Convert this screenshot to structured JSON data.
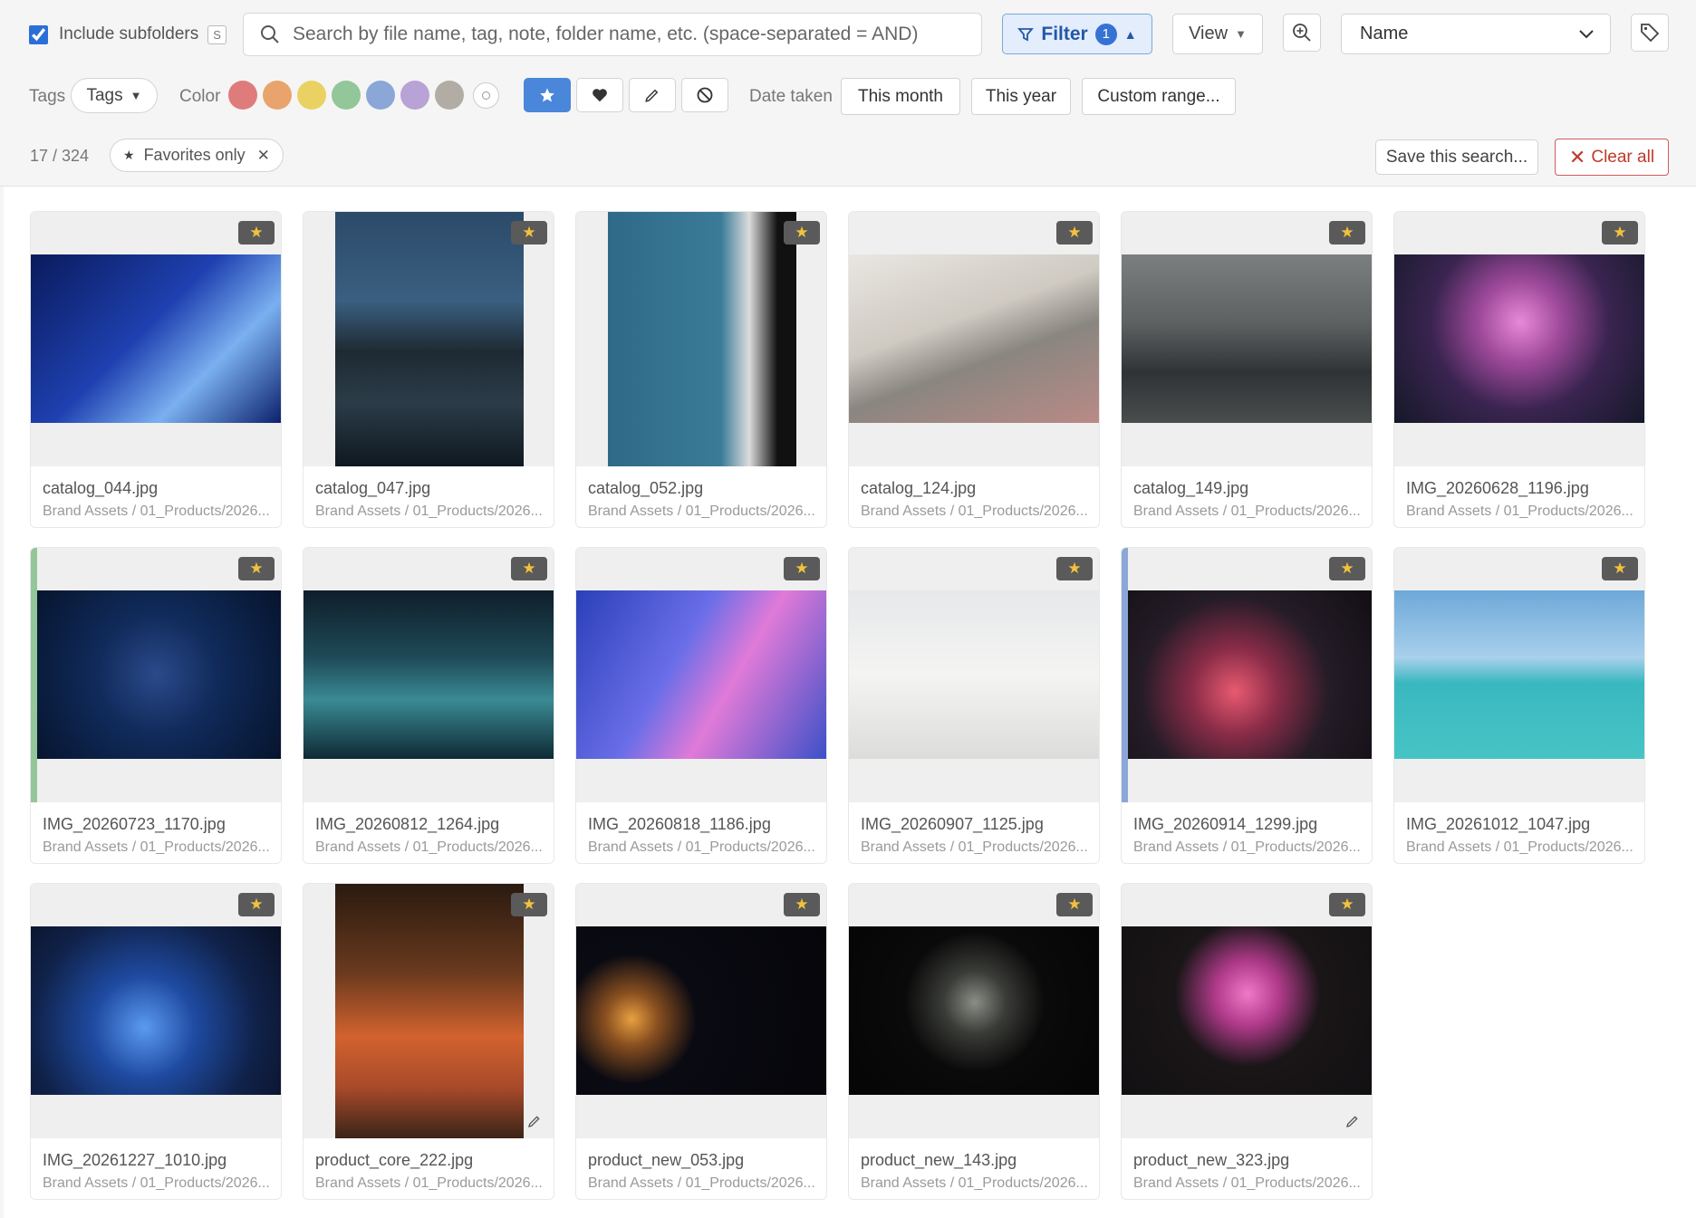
{
  "toolbar": {
    "include_subfolders": {
      "label": "Include subfolders",
      "shortcut": "S",
      "checked": true
    },
    "search": {
      "placeholder": "Search by file name, tag, note, folder name, etc. (space-separated = AND)",
      "value": ""
    },
    "filter": {
      "label": "Filter",
      "count": "1",
      "caret": "▲"
    },
    "view": {
      "label": "View",
      "caret": "▼"
    },
    "sort": {
      "selected": "Name",
      "options": [
        "Name"
      ]
    }
  },
  "filters": {
    "tags_label": "Tags",
    "tags_dropdown": "Tags",
    "color_label": "Color",
    "colors": [
      "#e07b7b",
      "#e8a46c",
      "#e9d263",
      "#93c699",
      "#8ba7d8",
      "#b9a2d6",
      "#b1ada4"
    ],
    "marks": [
      "star",
      "heart",
      "pencil",
      "none"
    ],
    "active_mark": "star",
    "date_label": "Date taken",
    "date_options": [
      "This month",
      "This year",
      "Custom range..."
    ]
  },
  "status": {
    "count": "17 / 324",
    "chip_label": "Favorites only",
    "save_label": "Save this search...",
    "clear_label": "Clear all"
  },
  "items": [
    {
      "name": "catalog_044.jpg",
      "path": "Brand Assets / 01_Products/2026...",
      "orientation": "landscape",
      "bg": "linear-gradient(135deg,#0a1a5c 0%,#1e40b0 45%,#7ab0f0 70%,#0a1f6a 100%)"
    },
    {
      "name": "catalog_047.jpg",
      "path": "Brand Assets / 01_Products/2026...",
      "orientation": "portrait",
      "bg": "linear-gradient(180deg,#2c4a6a 0%,#3a5f80 35%,#1e2a33 55%,#2b3c48 75%,#0f1820 100%)"
    },
    {
      "name": "catalog_052.jpg",
      "path": "Brand Assets / 01_Products/2026...",
      "orientation": "portrait",
      "bg": "linear-gradient(90deg,#2f6a88 0%,#3a7b98 60%,#dcdcdc 75%,#111 90%)"
    },
    {
      "name": "catalog_124.jpg",
      "path": "Brand Assets / 01_Products/2026...",
      "orientation": "landscape",
      "bg": "linear-gradient(160deg,#e9e6e1 0%,#cfcac2 40%,#8a8680 60%,#b98a86 100%)"
    },
    {
      "name": "catalog_149.jpg",
      "path": "Brand Assets / 01_Products/2026...",
      "orientation": "landscape",
      "bg": "linear-gradient(180deg,#7b7f80 0%,#5e6263 40%,#2f3335 70%,#4a4d4e 100%)"
    },
    {
      "name": "IMG_20260628_1196.jpg",
      "path": "Brand Assets / 01_Products/2026...",
      "orientation": "landscape",
      "bg": "radial-gradient(circle at 50% 40%,#e889d6 0%,#a04a9c 25%,#3a2450 55%,#141828 100%)"
    },
    {
      "name": "IMG_20260723_1170.jpg",
      "path": "Brand Assets / 01_Products/2026...",
      "orientation": "landscape",
      "bg": "radial-gradient(circle at 50% 50%,#2a4a8a 0%,#102a5a 40%,#06142c 100%)",
      "label_color": "#93c699"
    },
    {
      "name": "IMG_20260812_1264.jpg",
      "path": "Brand Assets / 01_Products/2026...",
      "orientation": "landscape",
      "bg": "linear-gradient(180deg,#0e1e2a 0%,#1f4a58 40%,#3a8a94 65%,#0e2a34 100%)"
    },
    {
      "name": "IMG_20260818_1186.jpg",
      "path": "Brand Assets / 01_Products/2026...",
      "orientation": "landscape",
      "bg": "linear-gradient(120deg,#2a40b8 0%,#6a6ee8 40%,#e07ad8 60%,#3a50c8 100%)"
    },
    {
      "name": "IMG_20260907_1125.jpg",
      "path": "Brand Assets / 01_Products/2026...",
      "orientation": "landscape",
      "bg": "linear-gradient(180deg,#e6e8ea 0%,#f4f4f2 50%,#dcdcda 100%)"
    },
    {
      "name": "IMG_20260914_1299.jpg",
      "path": "Brand Assets / 01_Products/2026...",
      "orientation": "landscape",
      "bg": "radial-gradient(circle at 45% 60%,#e85a70 0%,#8a2c48 25%,#241c26 55%,#120e14 100%)",
      "label_color": "#8ba7d8"
    },
    {
      "name": "IMG_20261012_1047.jpg",
      "path": "Brand Assets / 01_Products/2026...",
      "orientation": "landscape",
      "bg": "linear-gradient(180deg,#6ea8d8 0%,#a8d0ec 40%,#3ab8c0 55%,#46c4c4 100%)"
    },
    {
      "name": "IMG_20261227_1010.jpg",
      "path": "Brand Assets / 01_Products/2026...",
      "orientation": "landscape",
      "bg": "radial-gradient(circle at 45% 60%,#5a9af0 0%,#1e4aa0 30%,#10224a 65%,#0a1024 100%)"
    },
    {
      "name": "product_core_222.jpg",
      "path": "Brand Assets / 01_Products/2026...",
      "orientation": "portrait",
      "bg": "linear-gradient(180deg,#2a1a10 0%,#6a3a1e 35%,#d2622e 60%,#a84a2a 80%,#3a2418 100%)",
      "edited": true
    },
    {
      "name": "product_new_053.jpg",
      "path": "Brand Assets / 01_Products/2026...",
      "orientation": "landscape",
      "bg": "radial-gradient(circle at 22% 55%,#e8a040 0%,#8a5020 12%,#0a0a12 30%,#05050a 100%)"
    },
    {
      "name": "product_new_143.jpg",
      "path": "Brand Assets / 01_Products/2026...",
      "orientation": "landscape",
      "bg": "radial-gradient(circle at 50% 45%,#8a8e86 0%,#3a3c38 20%,#0a0a0a 45%,#050505 100%)"
    },
    {
      "name": "product_new_323.jpg",
      "path": "Brand Assets / 01_Products/2026...",
      "orientation": "landscape",
      "bg": "radial-gradient(circle at 50% 40%,#f07ac8 0%,#b03a8a 20%,#1a1618 45%,#121012 100%)",
      "edited": true
    }
  ]
}
